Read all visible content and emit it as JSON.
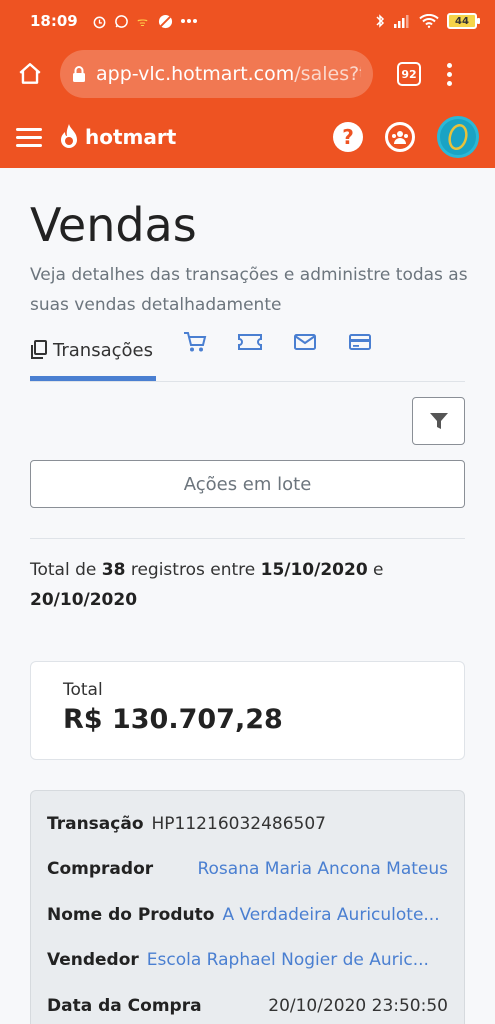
{
  "status_bar": {
    "time": "18:09",
    "battery": "44",
    "icons": [
      "alarm-icon",
      "whatsapp-icon",
      "app-icon",
      "blocked-icon",
      "more-icon",
      "bluetooth-icon",
      "signal-icon",
      "wifi-icon",
      "battery-icon"
    ]
  },
  "browser": {
    "url_main": "app-vlc.hotmart.com",
    "url_rest": "/sales?t",
    "tab_count": "92"
  },
  "header": {
    "logo_text": "hotmart",
    "help_label": "?"
  },
  "page": {
    "title": "Vendas",
    "subtitle": "Veja detalhes das transações e administre todas as suas vendas detalhadamente"
  },
  "tabs": [
    {
      "label": "Transações",
      "icon": "copy-icon",
      "active": true
    },
    {
      "label": "",
      "icon": "cart-icon",
      "active": false
    },
    {
      "label": "",
      "icon": "ticket-icon",
      "active": false
    },
    {
      "label": "",
      "icon": "mail-icon",
      "active": false
    },
    {
      "label": "",
      "icon": "credit-card-icon",
      "active": false
    }
  ],
  "actions": {
    "batch_label": "Ações em lote"
  },
  "summary": {
    "prefix": "Total de ",
    "count": "38",
    "middle": " registros entre ",
    "date_from": "15/10/2020",
    "and": " e",
    "date_to": "20/10/2020"
  },
  "total": {
    "label": "Total",
    "value": "R$ 130.707,28"
  },
  "transaction": {
    "rows": [
      {
        "key": "Transação",
        "value": "HP11216032486507"
      },
      {
        "key": "Comprador",
        "value": "Rosana Maria Ancona Mateus"
      },
      {
        "key": "Nome do Produto",
        "value": "A Verdadeira Auriculote..."
      },
      {
        "key": "Vendedor",
        "value": "Escola Raphael Nogier de Auric..."
      },
      {
        "key": "Data da Compra",
        "value": "20/10/2020 23:50:50"
      }
    ]
  },
  "colors": {
    "brand": "#ee5322",
    "link": "#4a7fd1"
  }
}
